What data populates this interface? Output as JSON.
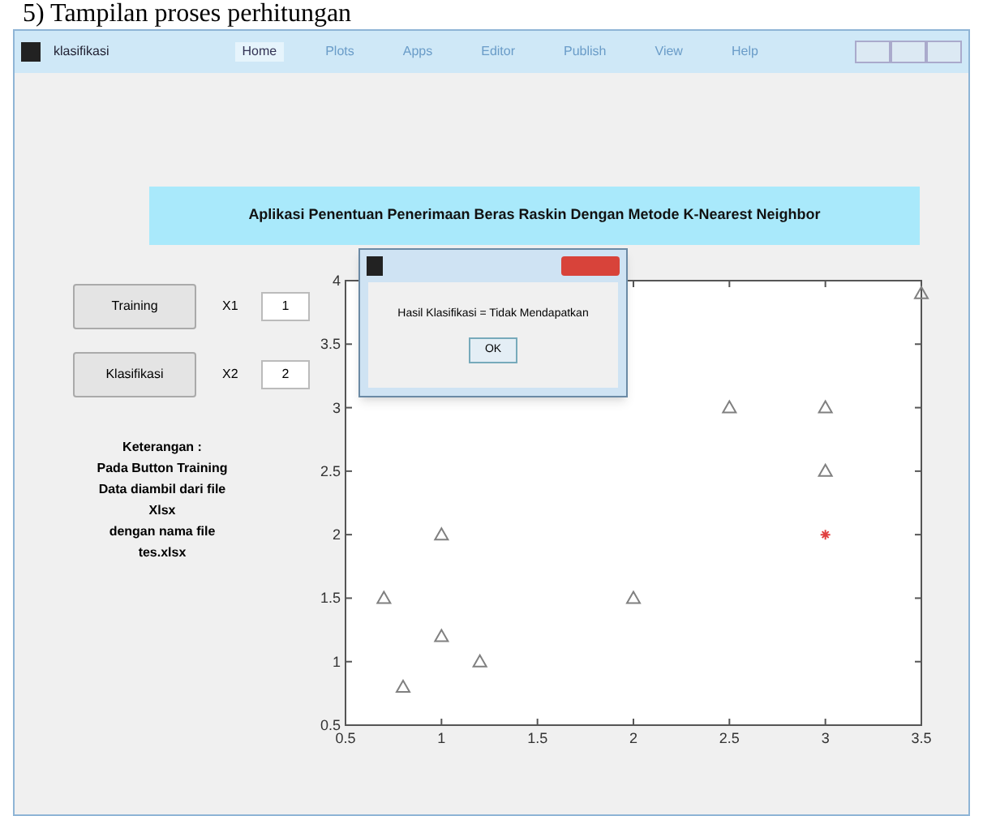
{
  "caption": "5)  Tampilan proses perhitungan",
  "window": {
    "title": "klasifikasi",
    "tabs": [
      {
        "label": "Home",
        "selected": true
      },
      {
        "label": "Plots",
        "selected": false
      },
      {
        "label": "Apps",
        "selected": false
      },
      {
        "label": "Editor",
        "selected": false
      },
      {
        "label": "Publish",
        "selected": false
      },
      {
        "label": "View",
        "selected": false
      },
      {
        "label": "Help",
        "selected": false
      }
    ]
  },
  "app_title": "Aplikasi Penentuan Penerimaan Beras Raskin Dengan Metode K-Nearest Neighbor",
  "controls": [
    {
      "button": "Training",
      "label": "X1",
      "value": "1"
    },
    {
      "button": "Klasifikasi",
      "label": "X2",
      "value": "2"
    }
  ],
  "note": [
    "Keterangan :",
    "Pada Button Training",
    "Data diambil dari file",
    "Xlsx",
    "dengan nama file",
    "tes.xlsx"
  ],
  "dialog": {
    "message": "Hasil Klasifikasi = Tidak Mendapatkan",
    "button": "OK"
  },
  "chart_data": {
    "type": "scatter",
    "xlim": [
      0.5,
      3.5
    ],
    "ylim": [
      0.5,
      4
    ],
    "xticks": [
      {
        "value": 0.5,
        "label": "0.5"
      },
      {
        "value": 1,
        "label": "1"
      },
      {
        "value": 1.5,
        "label": "1.5"
      },
      {
        "value": 2,
        "label": "2"
      },
      {
        "value": 2.5,
        "label": "2.5"
      },
      {
        "value": 3,
        "label": "3"
      },
      {
        "value": 3.5,
        "label": "3.5"
      }
    ],
    "yticks": [
      {
        "value": 0.5,
        "label": "0.5"
      },
      {
        "value": 1,
        "label": "1"
      },
      {
        "value": 1.5,
        "label": "1.5"
      },
      {
        "value": 2,
        "label": "2"
      },
      {
        "value": 2.5,
        "label": "2.5"
      },
      {
        "value": 3,
        "label": "3"
      },
      {
        "value": 3.5,
        "label": "3.5"
      },
      {
        "value": 4,
        "label": "4"
      }
    ],
    "x": [
      0.7,
      0.8,
      1,
      1,
      1.2,
      2,
      2.5,
      3,
      3,
      3,
      3.5
    ],
    "series": [
      {
        "color": "#808080",
        "marker": "triangle",
        "values": [
          1.5,
          0.8,
          2,
          1.2,
          1,
          1.5,
          3,
          3,
          2.5,
          null,
          3.9
        ]
      },
      {
        "color": "#e04040",
        "marker": "cross",
        "values": [
          null,
          null,
          null,
          null,
          null,
          null,
          null,
          null,
          null,
          2,
          null
        ]
      }
    ]
  }
}
